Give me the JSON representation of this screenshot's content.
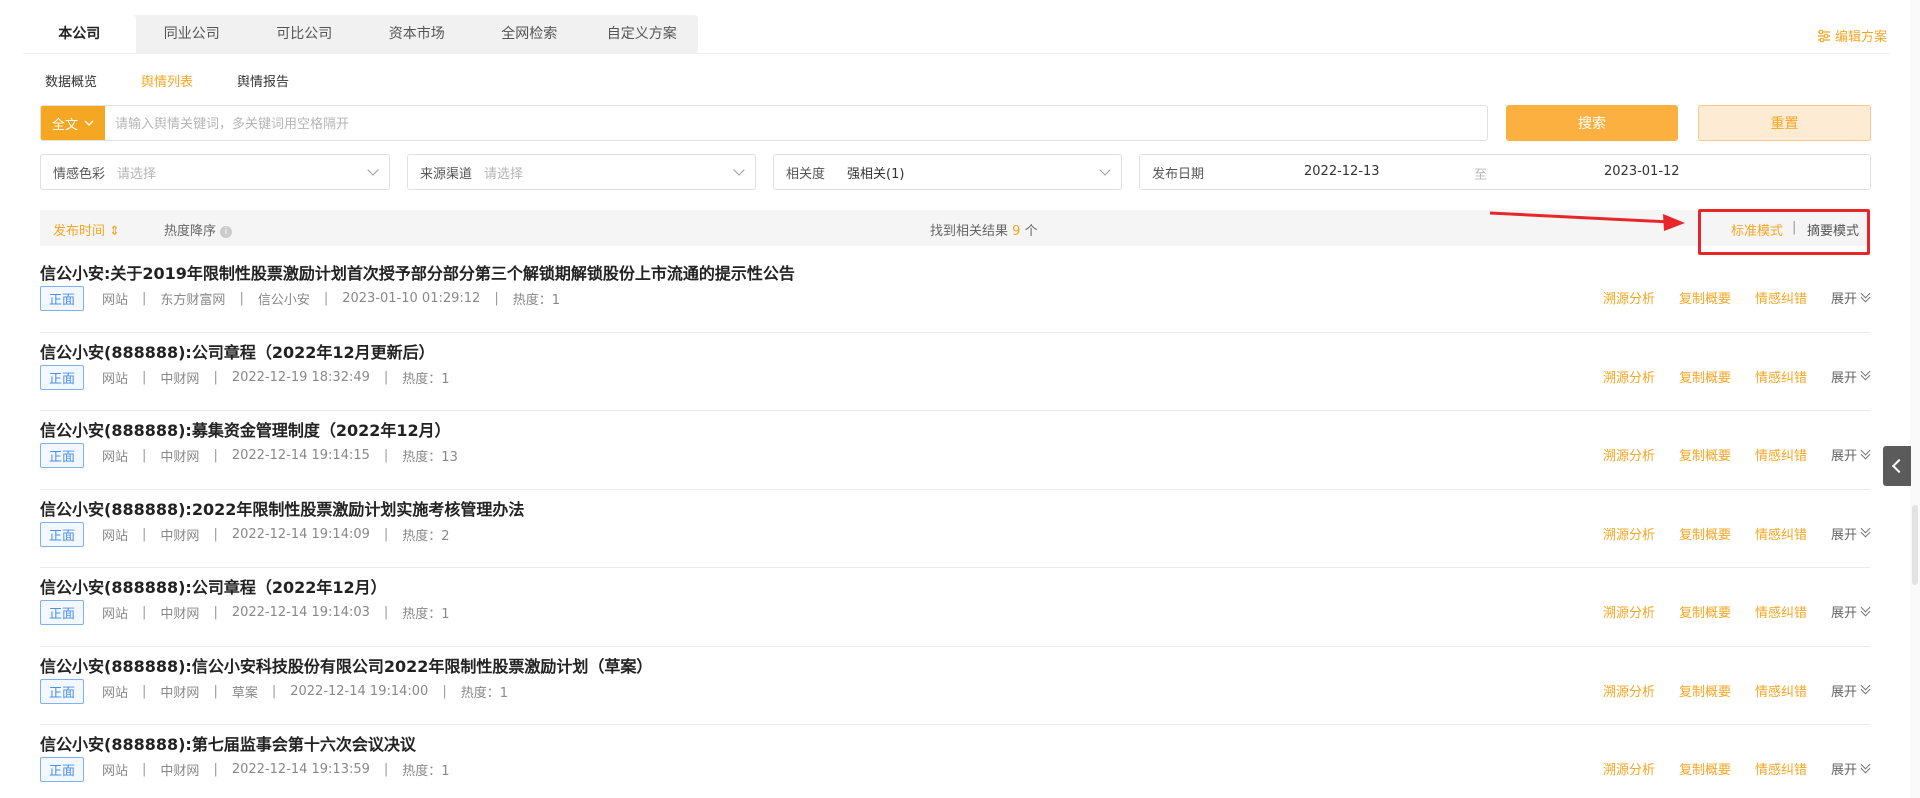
{
  "tabs": [
    {
      "label": "本公司",
      "active": true
    },
    {
      "label": "同业公司",
      "active": false
    },
    {
      "label": "可比公司",
      "active": false
    },
    {
      "label": "资本市场",
      "active": false
    },
    {
      "label": "全网检索",
      "active": false
    },
    {
      "label": "自定义方案",
      "active": false
    }
  ],
  "edit_scheme": {
    "label": "编辑方案",
    "icon": "sliders-icon"
  },
  "subtabs": [
    {
      "label": "数据概览",
      "active": false
    },
    {
      "label": "舆情列表",
      "active": true
    },
    {
      "label": "舆情报告",
      "active": false
    }
  ],
  "search": {
    "scope": "全文",
    "placeholder": "请输入舆情关键词，多关键词用空格隔开",
    "search_button": "搜索",
    "reset_button": "重置"
  },
  "filters": {
    "sentiment": {
      "label": "情感色彩",
      "placeholder": "请选择"
    },
    "source": {
      "label": "来源渠道",
      "placeholder": "请选择"
    },
    "relevance": {
      "label": "相关度",
      "value": "强相关(1)"
    },
    "date": {
      "label": "发布日期",
      "start": "2022-12-13",
      "sep": "至",
      "end": "2023-01-12"
    }
  },
  "sortbar": {
    "time": "发布时间 ⇕",
    "hot": "热度降序",
    "result_prefix": "找到相关结果",
    "result_count": "9",
    "result_suffix": "个",
    "mode_standard": "标准模式",
    "mode_sep": "|",
    "mode_abstract": "摘要模式"
  },
  "item_actions": {
    "trace": "溯源分析",
    "copy": "复制概要",
    "correct": "情感纠错",
    "expand": "展开"
  },
  "items": [
    {
      "title": "信公小安:关于2019年限制性股票激励计划首次授予部分部分第三个解锁期解锁股份上市流通的提示性公告",
      "sentiment": "正面",
      "meta": [
        "网站",
        "东方财富网",
        "信公小安",
        "2023-01-10 01:29:12",
        "热度：1"
      ]
    },
    {
      "title": "信公小安(888888):公司章程（2022年12月更新后）",
      "sentiment": "正面",
      "meta": [
        "网站",
        "中财网",
        "2022-12-19 18:32:49",
        "热度：1"
      ]
    },
    {
      "title": "信公小安(888888):募集资金管理制度（2022年12月）",
      "sentiment": "正面",
      "meta": [
        "网站",
        "中财网",
        "2022-12-14 19:14:15",
        "热度：13"
      ]
    },
    {
      "title": "信公小安(888888):2022年限制性股票激励计划实施考核管理办法",
      "sentiment": "正面",
      "meta": [
        "网站",
        "中财网",
        "2022-12-14 19:14:09",
        "热度：2"
      ]
    },
    {
      "title": "信公小安(888888):公司章程（2022年12月）",
      "sentiment": "正面",
      "meta": [
        "网站",
        "中财网",
        "2022-12-14 19:14:03",
        "热度：1"
      ]
    },
    {
      "title": "信公小安(888888):信公小安科技股份有限公司2022年限制性股票激励计划（草案）",
      "sentiment": "正面",
      "meta": [
        "网站",
        "中财网",
        "草案",
        "2022-12-14 19:14:00",
        "热度：1"
      ]
    },
    {
      "title": "信公小安(888888):第七届监事会第十六次会议决议",
      "sentiment": "正面",
      "meta": [
        "网站",
        "中财网",
        "2022-12-14 19:13:59",
        "热度：1"
      ]
    }
  ],
  "colors": {
    "accent": "#f5a623",
    "annotation": "#e8262a",
    "sentiment_blue": "#4a8ee8"
  }
}
